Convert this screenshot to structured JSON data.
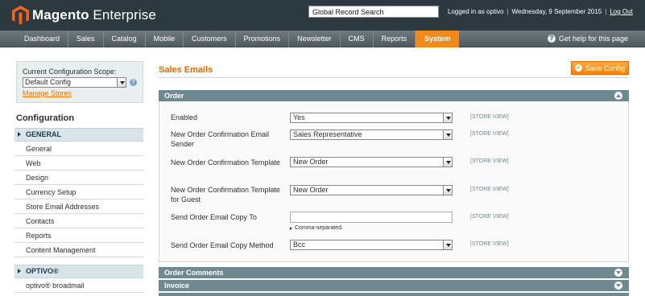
{
  "header": {
    "logo_bold": "Magento",
    "logo_light": "Enterprise",
    "search_value": "Global Record Search",
    "logged_in": "Logged in as optivo",
    "date": "Wednesday, 9 September 2015",
    "logout": "Log Out"
  },
  "nav": {
    "items": [
      "Dashboard",
      "Sales",
      "Catalog",
      "Mobile",
      "Customers",
      "Promotions",
      "Newsletter",
      "CMS",
      "Reports",
      "System"
    ],
    "active": "System",
    "help": "Get help for this page"
  },
  "scope": {
    "label": "Current Configuration Scope:",
    "value": "Default Config",
    "manage_link": "Manage Stores"
  },
  "sidebar": {
    "title": "Configuration",
    "sections": [
      {
        "label": "GENERAL",
        "items": [
          "General",
          "Web",
          "Design",
          "Currency Setup",
          "Store Email Addresses",
          "Contacts",
          "Reports",
          "Content Management"
        ]
      },
      {
        "label": "OPTIVO®",
        "items": [
          "optivo® broadmail"
        ]
      }
    ]
  },
  "main": {
    "title": "Sales Emails",
    "save_label": "Save Config",
    "fieldsets": [
      {
        "label": "Order",
        "expanded": true
      },
      {
        "label": "Order Comments",
        "expanded": false
      },
      {
        "label": "Invoice",
        "expanded": false
      }
    ],
    "fields": [
      {
        "label": "Enabled",
        "type": "select",
        "value": "Yes",
        "scope": "[STORE VIEW]"
      },
      {
        "label": "New Order Confirmation Email Sender",
        "type": "select",
        "value": "Sales Representative",
        "scope": "[STORE VIEW]"
      },
      {
        "label": "New Order Confirmation Template",
        "type": "select",
        "value": "New Order",
        "scope": "[STORE VIEW]"
      },
      {
        "label": "New Order Confirmation Template for Guest",
        "type": "select",
        "value": "New Order",
        "scope": "[STORE VIEW]"
      },
      {
        "label": "Send Order Email Copy To",
        "type": "text",
        "value": "",
        "note": "Comma-separated.",
        "scope": "[STORE VIEW]"
      },
      {
        "label": "Send Order Email Copy Method",
        "type": "select",
        "value": "Bcc",
        "scope": "[STORE VIEW]"
      }
    ]
  },
  "colors": {
    "header_bg": "#2c3a40",
    "accent_orange": "#f18a1c",
    "fieldset_head": "#6f8992",
    "section_bg": "#d9e5ea"
  }
}
